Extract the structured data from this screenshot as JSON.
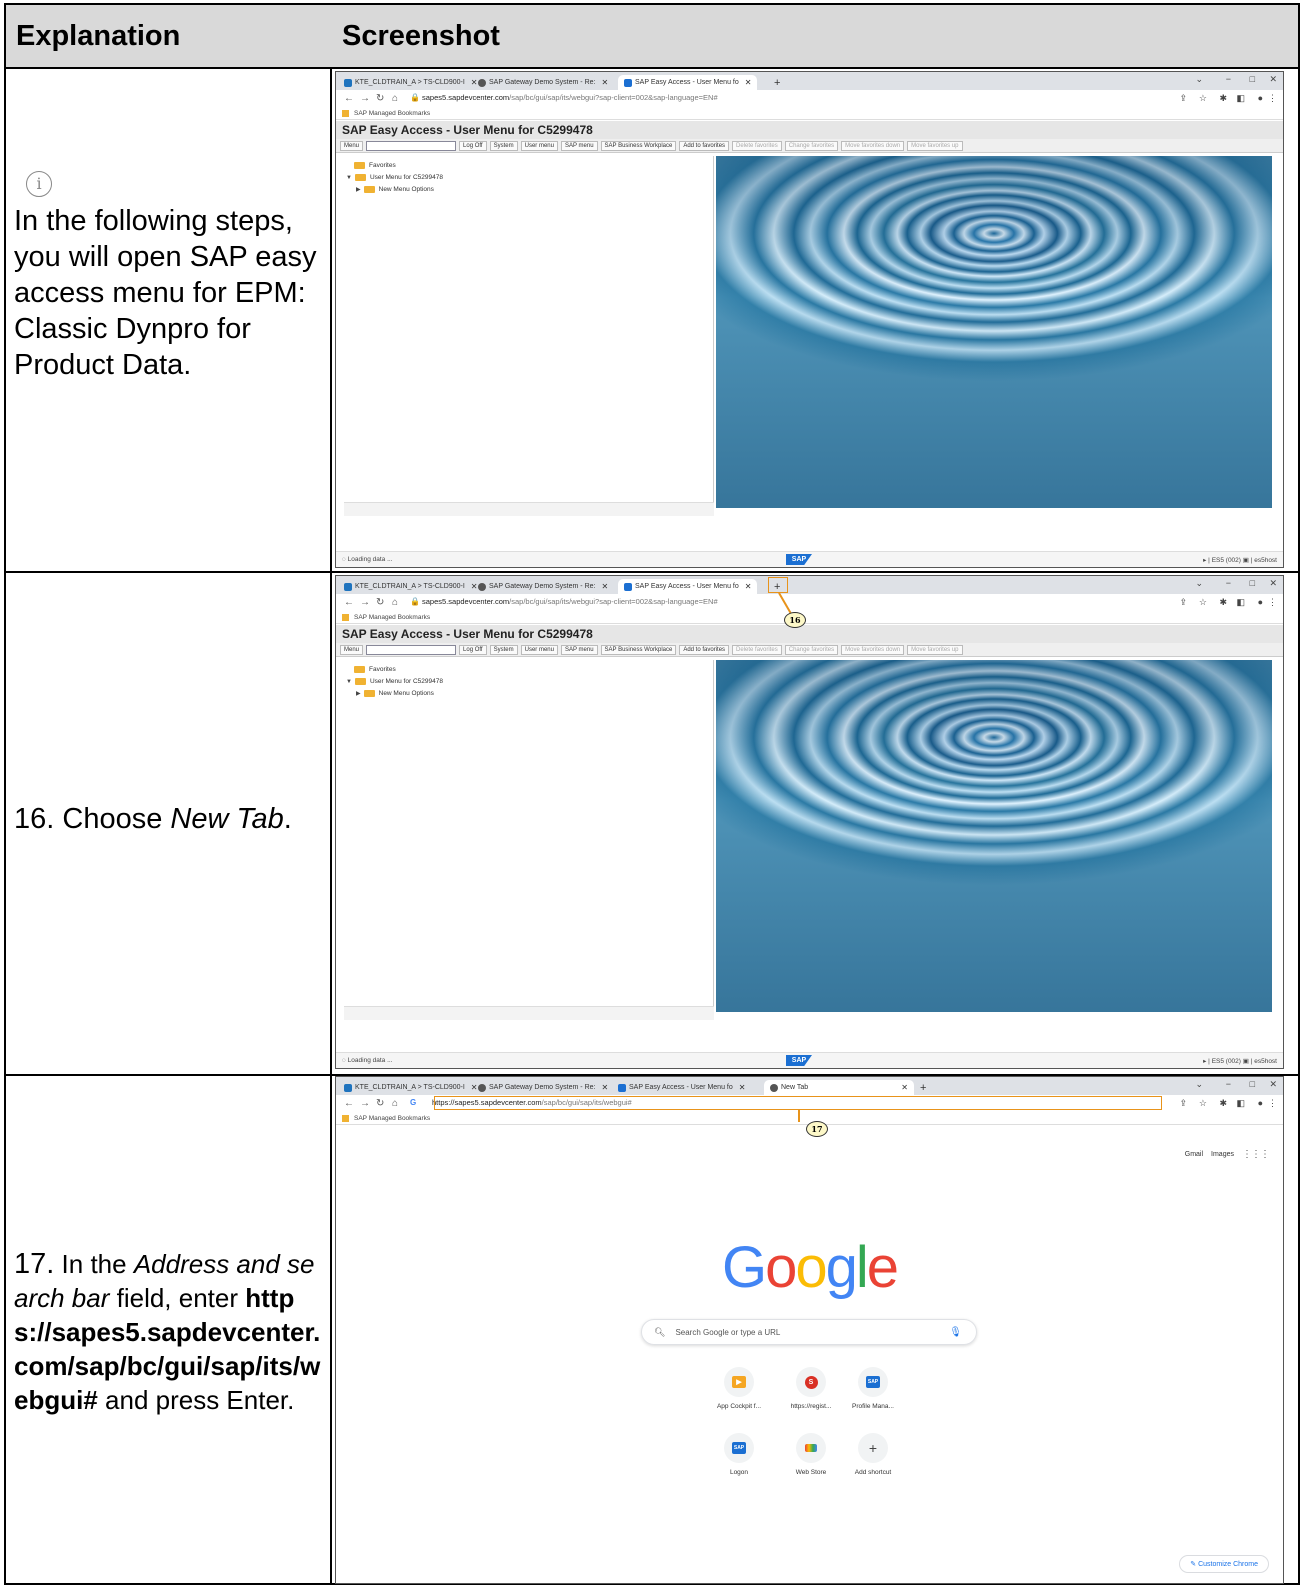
{
  "table": {
    "header_left": "Explanation",
    "header_right": "Screenshot"
  },
  "rows": {
    "intro": "In the following steps, you will open SAP easy access menu for EPM: Classic Dynpro for Product Data.",
    "step16_prefix": "16. Choose ",
    "step16_em": "New Tab",
    "step16_suffix": ".",
    "step17_prefix": "17.",
    "step17_text1": " In the ",
    "step17_em": "Address and search bar",
    "step17_text2": " field, enter ",
    "step17_bold": "https://sapes5.sapdevcenter.com/sap/bc/gui/sap/its/webgui#",
    "step17_text3": " and press Enter."
  },
  "browser": {
    "tab1": "KTE_CLDTRAIN_A > TS-CLD900-I",
    "tab2": "SAP Gateway Demo System - Re:",
    "tab3": "SAP Easy Access - User Menu fo",
    "tab4": "New Tab",
    "url_host": "sapes5.sapdevcenter.com",
    "url_path": "/sap/bc/gui/sap/its/webgui?sap-client=002&sap-language=EN#",
    "typed_url_host": "https://sapes5.sapdevcenter.com",
    "typed_url_path": "/sap/bc/gui/sap/its/webgui#",
    "bookmarks": "SAP Managed Bookmarks"
  },
  "sap": {
    "title": "SAP Easy Access  -  User Menu for C5299478",
    "toolbar": [
      "Menu",
      "Log Off",
      "System",
      "User menu",
      "SAP menu",
      "SAP Business Workplace",
      "Add to favorites"
    ],
    "toolbar_disabled": [
      "Delete favorites",
      "Change favorites",
      "Move favorites down",
      "Move favorites up"
    ],
    "tree_favorites": "Favorites",
    "tree_user_menu": "User Menu for C5299478",
    "tree_new_menu": "New Menu Options",
    "status_loading": "Loading data ...",
    "status_system": "ES5 (002)",
    "status_host": "es5host",
    "logo": "SAP"
  },
  "callouts": {
    "c16": "16",
    "c17": "17"
  },
  "newtab": {
    "gmail": "Gmail",
    "images": "Images",
    "search_placeholder": "Search Google or type a URL",
    "shortcuts": [
      "App Cockpit f...",
      "https://regist...",
      "Profile Mana...",
      "Logon",
      "Web Store",
      "Add shortcut"
    ],
    "customize": "Customize Chrome"
  },
  "colors": {
    "header_bg": "#d9d9d9",
    "callout": "#e8931a",
    "google_blue": "#4285f4",
    "google_red": "#ea4335",
    "google_yellow": "#fbbc05",
    "google_green": "#34a853"
  }
}
